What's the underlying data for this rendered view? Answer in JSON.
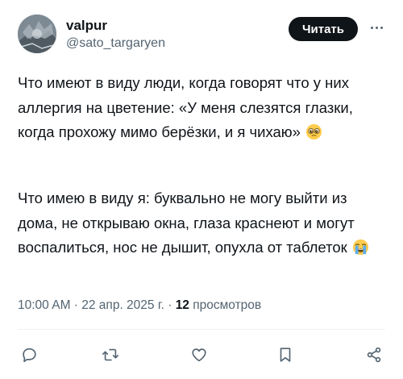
{
  "author": {
    "display_name": "valpur",
    "handle": "@sato_targaryen",
    "avatar_icon": "avatar-image"
  },
  "follow_button": {
    "label": "Читать"
  },
  "more_button": {
    "icon": "more-horizontal-icon"
  },
  "tweet": {
    "paragraph1": "Что имеют в виду люди, когда говорят что у них аллергия на цветение: «У меня слезятся глазки, когда прохожу мимо берёзки, и я чихаю»",
    "paragraph1_emoji": "pleading-face-icon",
    "paragraph2": "Что имею в виду я: буквально не могу выйти из дома, не открываю окна, глаза краснеют и могут воспалиться, нос не дышит, опухла от таблеток",
    "paragraph2_emoji": "loudly-crying-face-icon"
  },
  "meta": {
    "timestamp": "10:00 AM · 22 апр. 2025 г. · ",
    "views_count": "12",
    "views_label": " просмотров"
  },
  "actions": [
    {
      "name": "reply",
      "icon": "reply-icon"
    },
    {
      "name": "retweet",
      "icon": "retweet-icon"
    },
    {
      "name": "like",
      "icon": "heart-icon"
    },
    {
      "name": "bookmark",
      "icon": "bookmark-icon"
    },
    {
      "name": "share",
      "icon": "share-icon"
    }
  ],
  "colors": {
    "text_primary": "#0f1419",
    "text_secondary": "#536471",
    "button_bg": "#0f1419",
    "divider": "#eff3f4",
    "emoji_yellow": "#ffcc4d"
  }
}
